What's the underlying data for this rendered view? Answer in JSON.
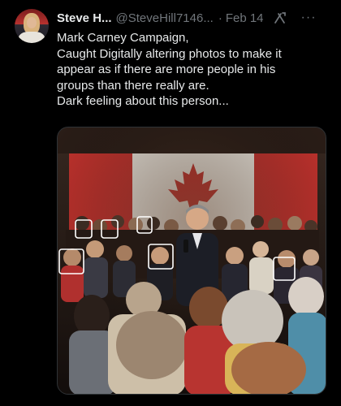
{
  "tweet": {
    "author_name": "Steve H...",
    "author_handle": "@SteveHill7146...",
    "separator": "·",
    "date": "Feb 14",
    "more_label": "···",
    "text_lines": [
      "Mark Carney Campaign,",
      "Caught Digitally altering photos to make it",
      "appear as if there are more people in his",
      "groups than there really are.",
      "Dark feeling about this person..."
    ]
  },
  "icons": {
    "avatar": "avatar-icon",
    "grok": "grok-icon",
    "more": "more-icon"
  },
  "colors": {
    "background": "#000000",
    "text": "#e7e9ea",
    "muted": "#71767b",
    "flag_red": "#c4332e",
    "highlight_box": "#ffffff"
  }
}
